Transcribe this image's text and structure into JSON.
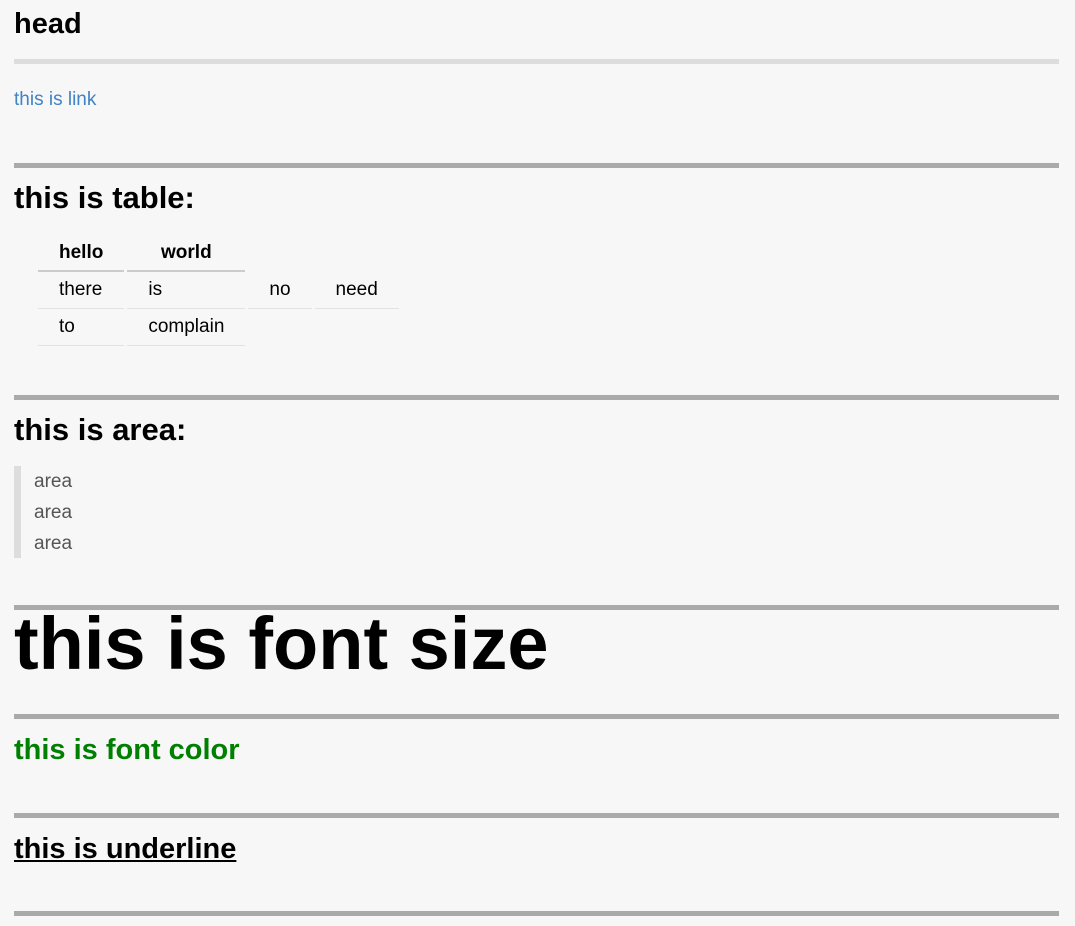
{
  "heading": "head",
  "link_text": "this is link",
  "table_section": {
    "title": "this is table:",
    "headers": [
      "hello",
      "world"
    ],
    "rows": [
      [
        "there",
        "is",
        "no",
        "need"
      ],
      [
        "to",
        "complain"
      ]
    ]
  },
  "area_section": {
    "title": "this is area:",
    "lines": [
      "area",
      "area",
      "area"
    ]
  },
  "font_size_text": "this is font size",
  "font_color_text": "this is font color",
  "underline_text": "this is underline",
  "colors": {
    "link": "#4183c4",
    "font_color": "#008000",
    "rule": "#aaaaaa",
    "rule_light": "#dddddd",
    "background": "#f7f7f7"
  }
}
